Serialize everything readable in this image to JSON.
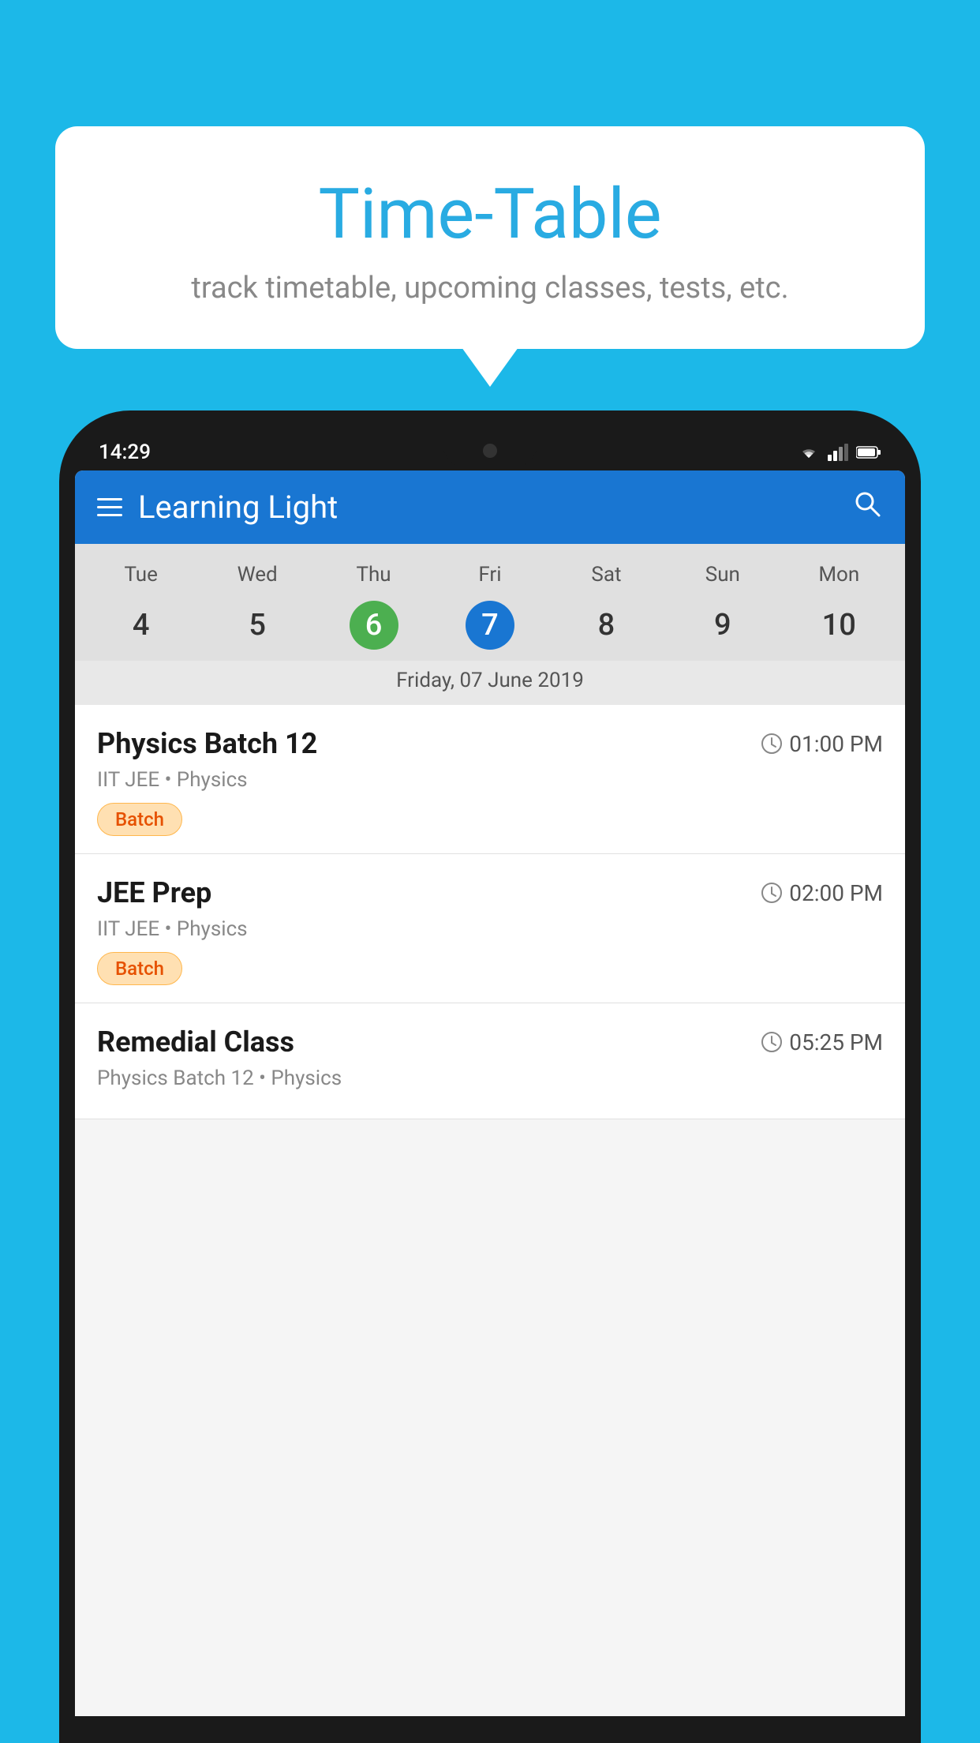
{
  "page": {
    "background_color": "#1CB8E8"
  },
  "speech_bubble": {
    "title": "Time-Table",
    "subtitle": "track timetable, upcoming classes, tests, etc."
  },
  "phone": {
    "status_bar": {
      "time": "14:29"
    },
    "app_bar": {
      "title": "Learning Light",
      "menu_icon": "hamburger-icon",
      "search_icon": "search-icon"
    },
    "calendar": {
      "days_of_week": [
        "Tue",
        "Wed",
        "Thu",
        "Fri",
        "Sat",
        "Sun",
        "Mon"
      ],
      "dates": [
        "4",
        "5",
        "6",
        "7",
        "8",
        "9",
        "10"
      ],
      "today_index": 2,
      "selected_index": 3,
      "selected_label": "Friday, 07 June 2019"
    },
    "schedule_items": [
      {
        "title": "Physics Batch 12",
        "time": "01:00 PM",
        "subtitle": "IIT JEE • Physics",
        "badge": "Batch"
      },
      {
        "title": "JEE Prep",
        "time": "02:00 PM",
        "subtitle": "IIT JEE • Physics",
        "badge": "Batch"
      },
      {
        "title": "Remedial Class",
        "time": "05:25 PM",
        "subtitle": "Physics Batch 12 • Physics",
        "badge": ""
      }
    ]
  }
}
